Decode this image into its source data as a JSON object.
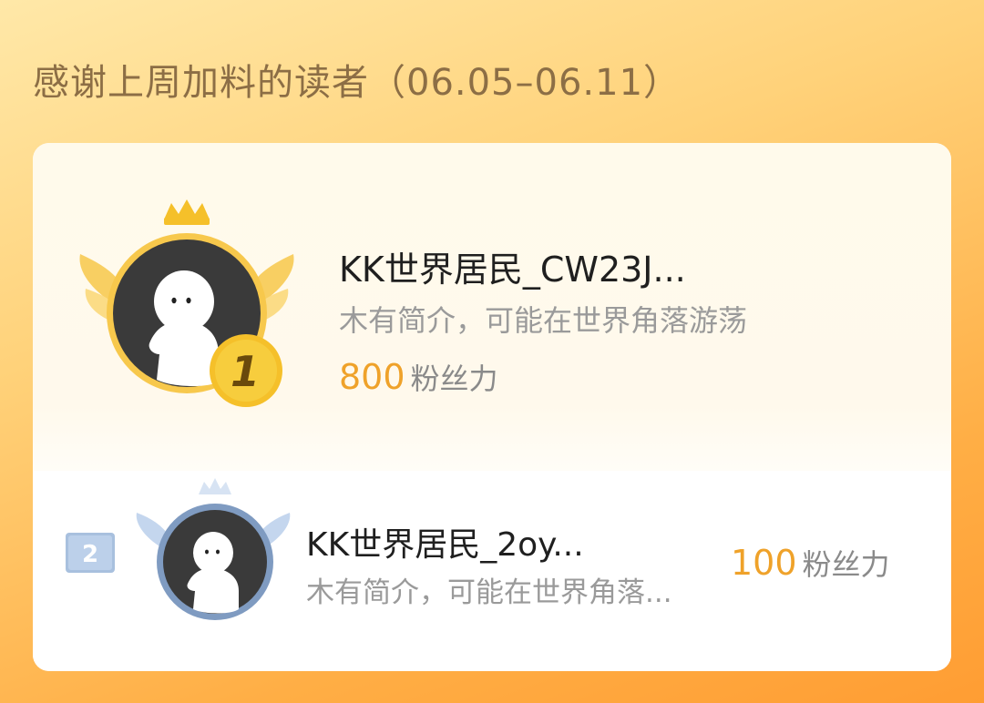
{
  "header": {
    "title": "感谢上周加料的读者（06.05–06.11）"
  },
  "readers": [
    {
      "rank": "1",
      "name": "KK世界居民_CW23J...",
      "bio": "木有简介，可能在世界角落游荡",
      "fans_value": "800",
      "fans_unit": "粉丝力"
    },
    {
      "rank": "2",
      "name": "KK世界居民_2oy...",
      "bio": "木有简介，可能在世界角落...",
      "fans_value": "100",
      "fans_unit": "粉丝力"
    }
  ],
  "colors": {
    "gold": "#efa22a",
    "title": "#8c6e45",
    "silver": "#8ea8c8"
  }
}
